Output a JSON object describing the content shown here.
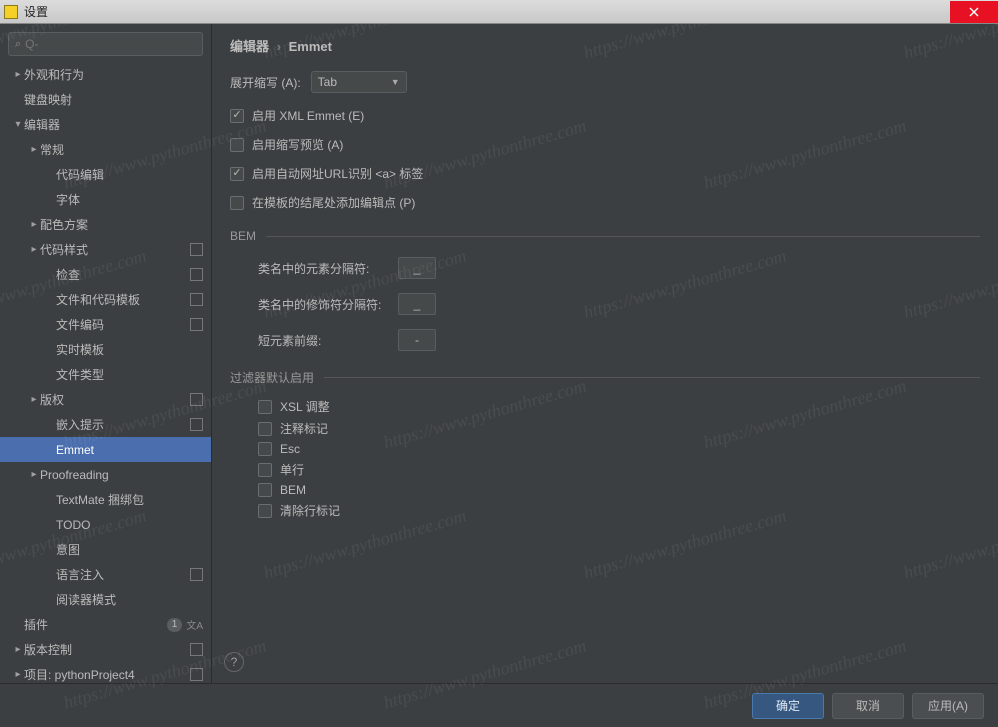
{
  "window": {
    "title": "设置"
  },
  "search": {
    "placeholder": "Q-"
  },
  "sidebar": {
    "items": [
      {
        "label": "外观和行为",
        "depth": 0,
        "arrow": "right",
        "sel": false
      },
      {
        "label": "键盘映射",
        "depth": 0,
        "arrow": "",
        "sel": false
      },
      {
        "label": "编辑器",
        "depth": 0,
        "arrow": "down",
        "sel": false
      },
      {
        "label": "常规",
        "depth": 1,
        "arrow": "right",
        "sel": false
      },
      {
        "label": "代码编辑",
        "depth": 2,
        "arrow": "",
        "sel": false
      },
      {
        "label": "字体",
        "depth": 2,
        "arrow": "",
        "sel": false
      },
      {
        "label": "配色方案",
        "depth": 1,
        "arrow": "right",
        "sel": false
      },
      {
        "label": "代码样式",
        "depth": 1,
        "arrow": "right",
        "sel": false,
        "proj": true
      },
      {
        "label": "检查",
        "depth": 2,
        "arrow": "",
        "sel": false,
        "proj": true
      },
      {
        "label": "文件和代码模板",
        "depth": 2,
        "arrow": "",
        "sel": false,
        "proj": true
      },
      {
        "label": "文件编码",
        "depth": 2,
        "arrow": "",
        "sel": false,
        "proj": true
      },
      {
        "label": "实时模板",
        "depth": 2,
        "arrow": "",
        "sel": false
      },
      {
        "label": "文件类型",
        "depth": 2,
        "arrow": "",
        "sel": false
      },
      {
        "label": "版权",
        "depth": 1,
        "arrow": "right",
        "sel": false,
        "proj": true
      },
      {
        "label": "嵌入提示",
        "depth": 2,
        "arrow": "",
        "sel": false,
        "proj": true
      },
      {
        "label": "Emmet",
        "depth": 2,
        "arrow": "",
        "sel": true
      },
      {
        "label": "Proofreading",
        "depth": 1,
        "arrow": "right",
        "sel": false
      },
      {
        "label": "TextMate 捆绑包",
        "depth": 2,
        "arrow": "",
        "sel": false
      },
      {
        "label": "TODO",
        "depth": 2,
        "arrow": "",
        "sel": false
      },
      {
        "label": "意图",
        "depth": 2,
        "arrow": "",
        "sel": false
      },
      {
        "label": "语言注入",
        "depth": 2,
        "arrow": "",
        "sel": false,
        "proj": true
      },
      {
        "label": "阅读器模式",
        "depth": 2,
        "arrow": "",
        "sel": false
      },
      {
        "label": "插件",
        "depth": 0,
        "arrow": "",
        "sel": false,
        "badge": "1",
        "lang": true
      },
      {
        "label": "版本控制",
        "depth": 0,
        "arrow": "right",
        "sel": false,
        "proj": true
      },
      {
        "label": "项目: pythonProject4",
        "depth": 0,
        "arrow": "right",
        "sel": false,
        "proj": true
      }
    ]
  },
  "breadcrumb": {
    "root": "编辑器",
    "current": "Emmet"
  },
  "expand": {
    "label": "展开缩写 (A):",
    "value": "Tab"
  },
  "checks": [
    {
      "label": "启用 XML Emmet (E)",
      "checked": true
    },
    {
      "label": "启用缩写预览 (A)",
      "checked": false
    },
    {
      "label": "启用自动网址URL识别 <a> 标签",
      "checked": true
    },
    {
      "label": "在模板的结尾处添加编辑点 (P)",
      "checked": false
    }
  ],
  "bem": {
    "title": "BEM",
    "rows": [
      {
        "label": "类名中的元素分隔符:",
        "value": "_"
      },
      {
        "label": "类名中的修饰符分隔符:",
        "value": "_"
      },
      {
        "label": "短元素前缀:",
        "value": "-"
      }
    ]
  },
  "filters": {
    "title": "过滤器默认启用",
    "items": [
      {
        "label": "XSL 调整",
        "checked": false
      },
      {
        "label": "注释标记",
        "checked": false
      },
      {
        "label": "Esc",
        "checked": false
      },
      {
        "label": "单行",
        "checked": false
      },
      {
        "label": "BEM",
        "checked": false
      },
      {
        "label": "清除行标记",
        "checked": false
      }
    ]
  },
  "buttons": {
    "ok": "确定",
    "cancel": "取消",
    "apply": "应用(A)"
  },
  "watermark": "https://www.pythonthree.com"
}
